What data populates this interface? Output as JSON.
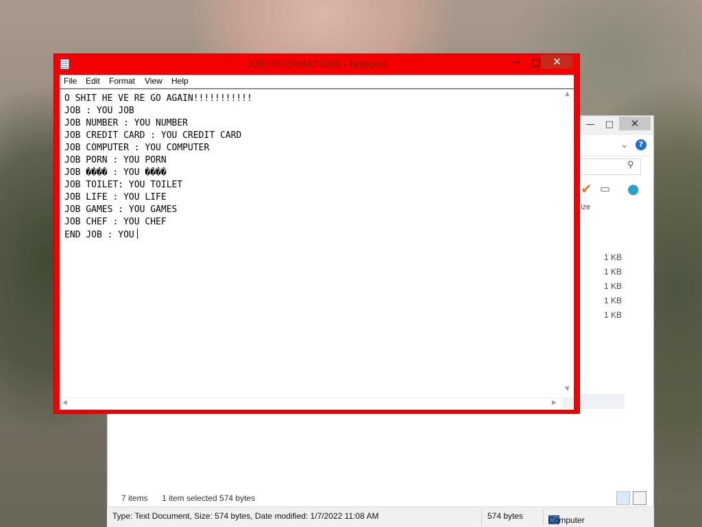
{
  "explorer": {
    "controls": {
      "minimize": "—",
      "maximize": "□",
      "close": "✕"
    },
    "chevron": "⌄",
    "help": "?",
    "size_header": "ize",
    "sizes": [
      "1 KB",
      "1 KB",
      "1 KB",
      "1 KB",
      "1 KB"
    ],
    "status_items": "7 items",
    "status_selected": "1 item selected  574 bytes"
  },
  "details_bar": {
    "type_info": "Type: Text Document, Size: 574 bytes, Date modified: 1/7/2022 11:08 AM",
    "size": "574 bytes",
    "location": "Computer"
  },
  "notepad": {
    "title": "JOB INFORMATIONS - Notepad",
    "controls": {
      "minimize": "—",
      "maximize": "□",
      "close": "✕"
    },
    "menu": [
      "File",
      "Edit",
      "Format",
      "View",
      "Help"
    ],
    "lines": [
      "O SHIT HE VE RE GO AGAIN!!!!!!!!!!!",
      "JOB : YOU JOB",
      "JOB NUMBER : YOU NUMBER",
      "JOB CREDIT CARD : YOU CREDIT CARD",
      "JOB COMPUTER : YOU COMPUTER",
      "JOB PORN : YOU PORN",
      "JOB ���� : YOU ����",
      "JOB TOILET: YOU TOILET",
      "JOB LIFE : YOU LIFE",
      "JOB GAMES : YOU GAMES",
      "JOB CHEF : YOU CHEF",
      "END JOB : YOU"
    ],
    "accent_color": "#f50000"
  }
}
